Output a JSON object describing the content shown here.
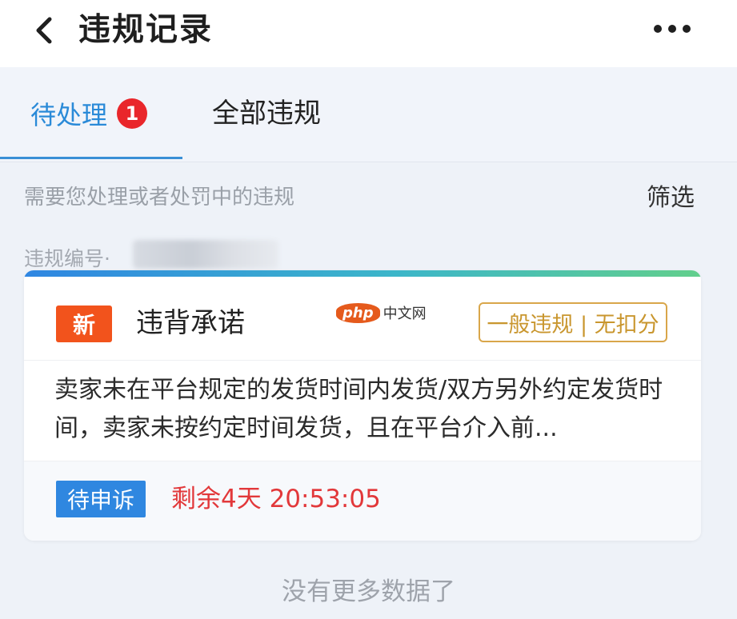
{
  "header": {
    "back_icon": "chevron-left-icon",
    "title": "违规记录",
    "more_icon": "more-dots-icon"
  },
  "tabs": {
    "pending_label": "待处理",
    "pending_count": "1",
    "all_label": "全部违规",
    "active": "待处理"
  },
  "hint": "需要您处理或者处罚中的违规",
  "filter_label": "筛选",
  "violation_id_label": "违规编号·",
  "card": {
    "new_tag": "新",
    "type": "违背承诺",
    "level": "一般违规 | 无扣分",
    "description": "卖家未在平台规定的发货时间内发货/双方另外约定发货时间，卖家未按约定时间发货，且在平台介入前...",
    "status": "待申诉",
    "countdown": "剩余4天 20:53:05",
    "watermark_php": "php",
    "watermark_cn": "中文网"
  },
  "footer_text": "没有更多数据了",
  "colors": {
    "accent_blue": "#2f87e0",
    "badge_red": "#e9262b",
    "new_orange": "#f2531c",
    "countdown_red": "#e2383a",
    "level_gold": "#d9a64a"
  }
}
